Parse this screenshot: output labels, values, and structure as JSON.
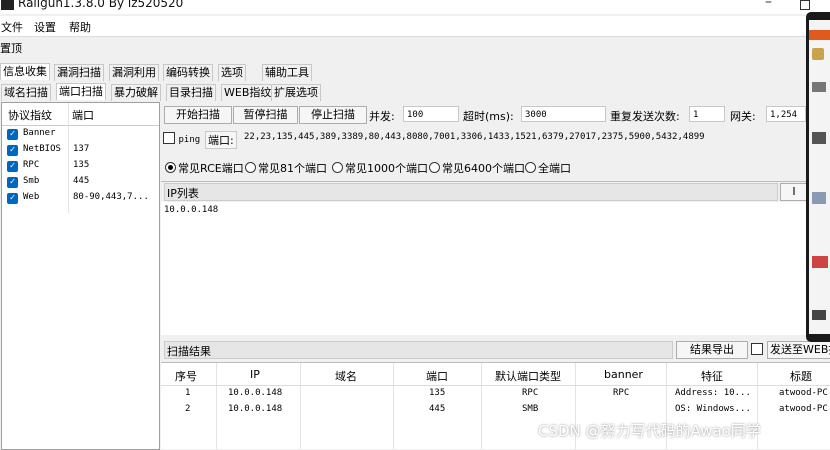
{
  "window": {
    "title": "Railgun1.3.8.0 By lz520520"
  },
  "menu": [
    "文件",
    "设置",
    "帮助"
  ],
  "pin_label": "置顶",
  "main_tabs": [
    "信息收集",
    "漏洞扫描",
    "漏洞利用",
    "编码转换",
    "选项",
    "辅助工具"
  ],
  "sub_tabs": [
    "域名扫描",
    "端口扫描",
    "暴力破解",
    "目录扫描",
    "WEB指纹",
    "扩展选项"
  ],
  "protocol_table": {
    "headers": [
      "协议指纹",
      "端口"
    ],
    "rows": [
      {
        "name": "Banner",
        "port": ""
      },
      {
        "name": "NetBIOS",
        "port": "137"
      },
      {
        "name": "RPC",
        "port": "135"
      },
      {
        "name": "Smb",
        "port": "445"
      },
      {
        "name": "Web",
        "port": "80-90,443,7..."
      }
    ]
  },
  "toolbar": {
    "start_label": "开始扫描",
    "pause_label": "暂停扫描",
    "stop_label": "停止扫描",
    "concurrency_label": "并发:",
    "concurrency_value": "100",
    "timeout_label": "超时(ms):",
    "timeout_value": "3000",
    "retry_label": "重复发送次数:",
    "retry_value": "1",
    "gateway_label": "网关:",
    "gateway_value": "1,254"
  },
  "ping_label": "ping",
  "ports_label": "端口:",
  "ports_value": "22,23,135,445,389,3389,80,443,8080,7001,3306,1433,1521,6379,27017,2375,5900,5432,4899",
  "port_presets": [
    "常见RCE端口",
    "常见81个端口",
    "常见1000个端口",
    "常见6400个端口",
    "全端口"
  ],
  "ip_list": {
    "title": "IP列表",
    "value": "10.0.0.148"
  },
  "results": {
    "title": "扫描结果",
    "export_label": "结果导出",
    "send_label": "发送至WEB指",
    "headers": [
      "序号",
      "IP",
      "域名",
      "端口",
      "默认端口类型",
      "banner",
      "特征",
      "标题"
    ],
    "rows": [
      [
        "1",
        "10.0.0.148",
        "",
        "135",
        "RPC",
        "RPC",
        "Address: 10...",
        "atwood-PC"
      ],
      [
        "2",
        "10.0.0.148",
        "",
        "445",
        "SMB",
        "",
        "OS: Windows...",
        "atwood-PC"
      ]
    ]
  },
  "watermark": "CSDN @努力写代码的Awao同学",
  "colors": {
    "accent": "#0067c0",
    "tab_active": "#ffffff",
    "background": "#f0f0f0"
  }
}
